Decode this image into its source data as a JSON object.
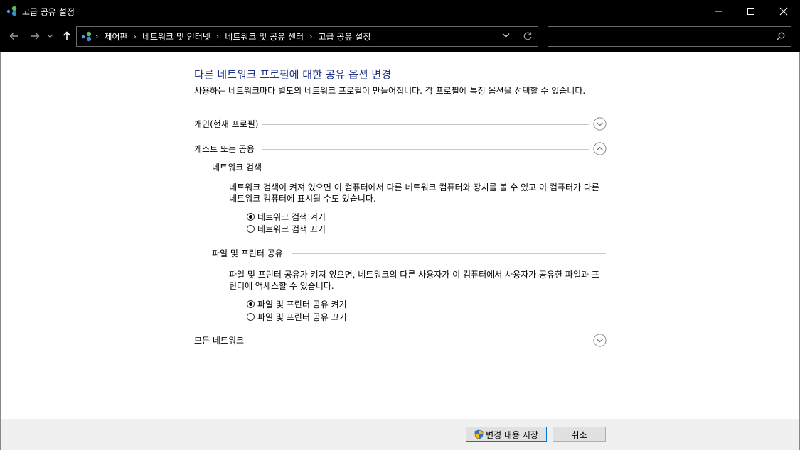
{
  "window": {
    "title": "고급 공유 설정",
    "icon": "network-sharing-icon"
  },
  "address": {
    "breadcrumbs": [
      "제어판",
      "네트워크 및 인터넷",
      "네트워크 및 공유 센터",
      "고급 공유 설정"
    ]
  },
  "search": {
    "value": "",
    "placeholder": ""
  },
  "main": {
    "title": "다른 네트워크 프로필에 대한 공유 옵션 변경",
    "description": "사용하는 네트워크마다 별도의 네트워크 프로필이 만들어집니다. 각 프로필에 특정 옵션을 선택할 수 있습니다.",
    "profiles": [
      {
        "label": "개인(현재 프로필)",
        "expanded": false
      },
      {
        "label": "게스트 또는 공용",
        "expanded": true
      },
      {
        "label": "모든 네트워크",
        "expanded": false
      }
    ],
    "discovery": {
      "heading": "네트워크 검색",
      "text": "네트워크 검색이 켜져 있으면 이 컴퓨터에서 다른 네트워크 컴퓨터와 장치를 볼 수 있고 이 컴퓨터가 다른 네트워크 컴퓨터에 표시될 수도 있습니다.",
      "options": [
        {
          "label": "네트워크 검색 켜기",
          "selected": true
        },
        {
          "label": "네트워크 검색 끄기",
          "selected": false
        }
      ]
    },
    "filesharing": {
      "heading": "파일 및 프린터 공유",
      "text": "파일 및 프린터 공유가 켜져 있으면, 네트워크의 다른 사용자가 이 컴퓨터에서 사용자가 공유한 파일과 프린터에 액세스할 수 있습니다.",
      "options": [
        {
          "label": "파일 및 프린터 공유 켜기",
          "selected": true
        },
        {
          "label": "파일 및 프린터 공유 끄기",
          "selected": false
        }
      ]
    }
  },
  "footer": {
    "save_label": "변경 내용 저장",
    "cancel_label": "취소"
  }
}
